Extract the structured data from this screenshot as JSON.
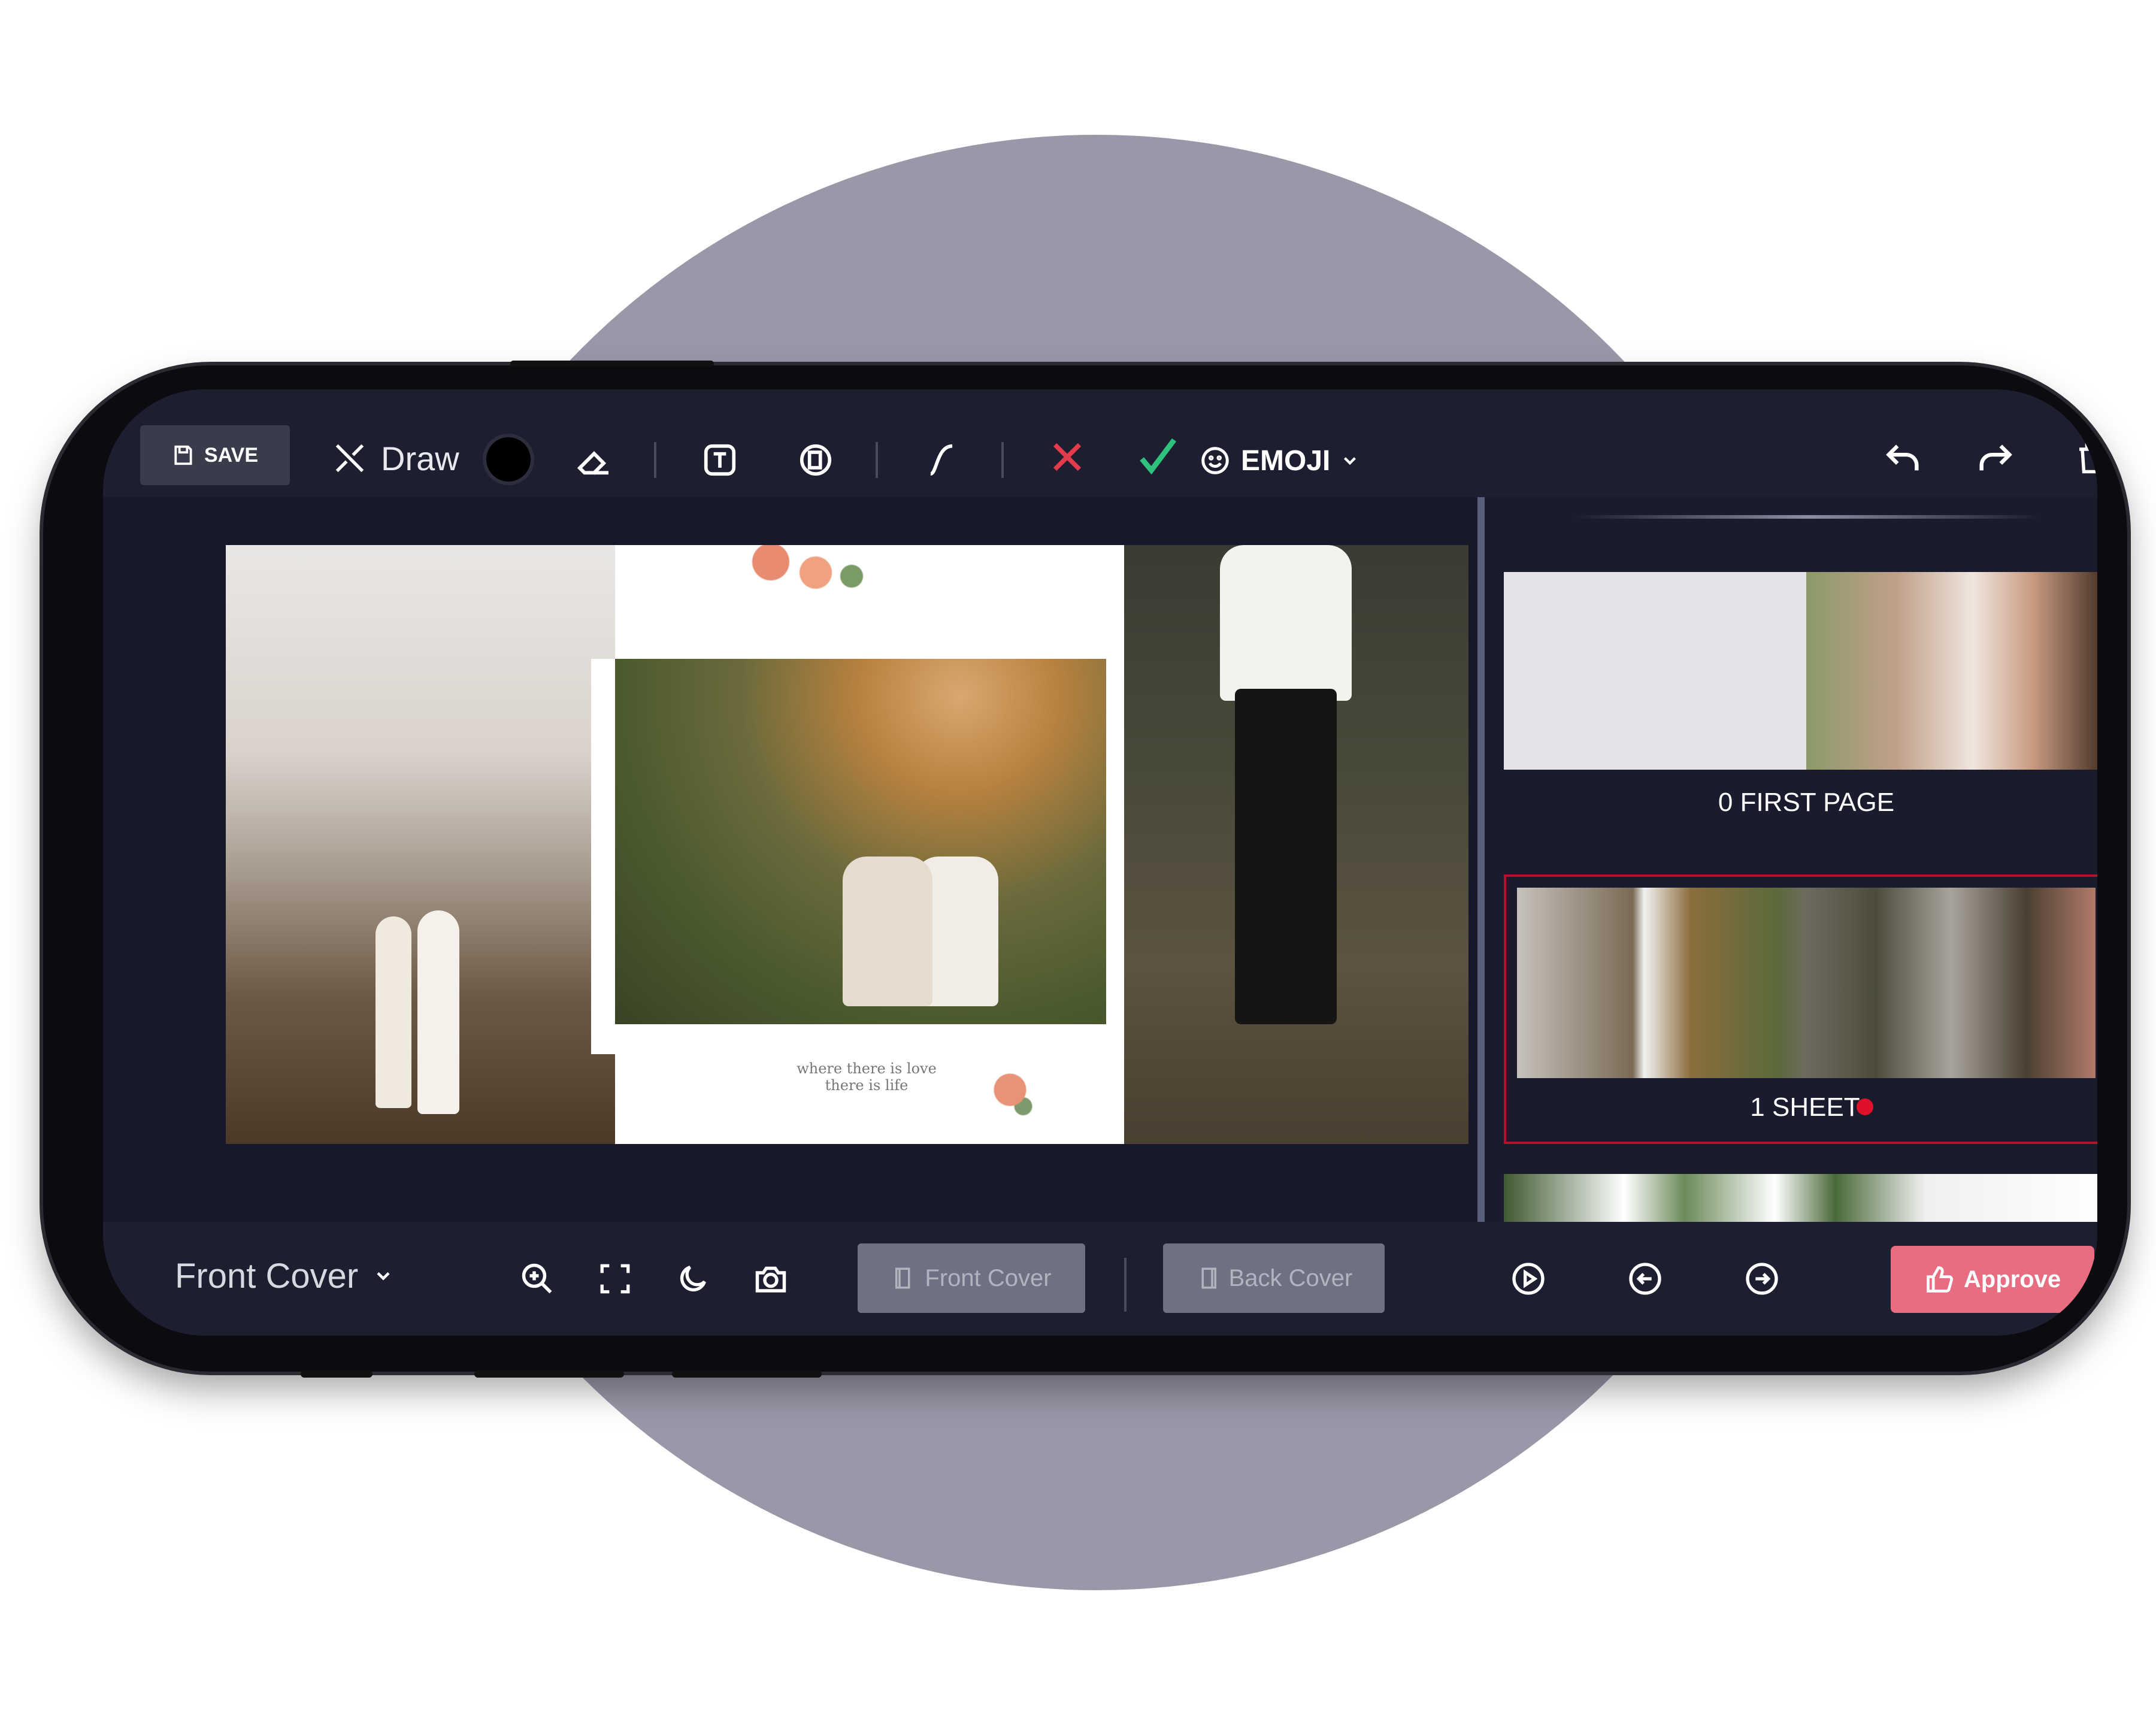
{
  "toolbar": {
    "save_label": "SAVE",
    "draw_label": "Draw",
    "emoji_label": "EMOJI",
    "icons": [
      "save-icon",
      "draw-icon",
      "color-swatch",
      "eraser-icon",
      "text-icon",
      "sticker-icon",
      "curve-icon",
      "close-icon",
      "check-icon",
      "emoji-icon",
      "undo-icon",
      "redo-icon",
      "trash-icon"
    ],
    "colors": {
      "close": "#e23b4a",
      "check": "#2ec27e",
      "swatch": "#000000"
    }
  },
  "canvas": {
    "quote_line1": "where there is love",
    "quote_line2": "there is life"
  },
  "panel": {
    "items": [
      {
        "label": "0 FIRST PAGE"
      },
      {
        "label": "1 SHEET",
        "selected": true
      }
    ]
  },
  "bottombar": {
    "page_select": "Front Cover",
    "front_cover_label": "Front Cover",
    "back_cover_label": "Back Cover",
    "approve_label": "Approve",
    "icons": [
      "zoom-in-icon",
      "fullscreen-icon",
      "dark-mode-icon",
      "camera-icon",
      "play-icon",
      "prev-icon",
      "next-icon",
      "thumbs-up-icon"
    ],
    "colors": {
      "approve": "#e86d80",
      "selected_border": "#b2122a"
    }
  }
}
